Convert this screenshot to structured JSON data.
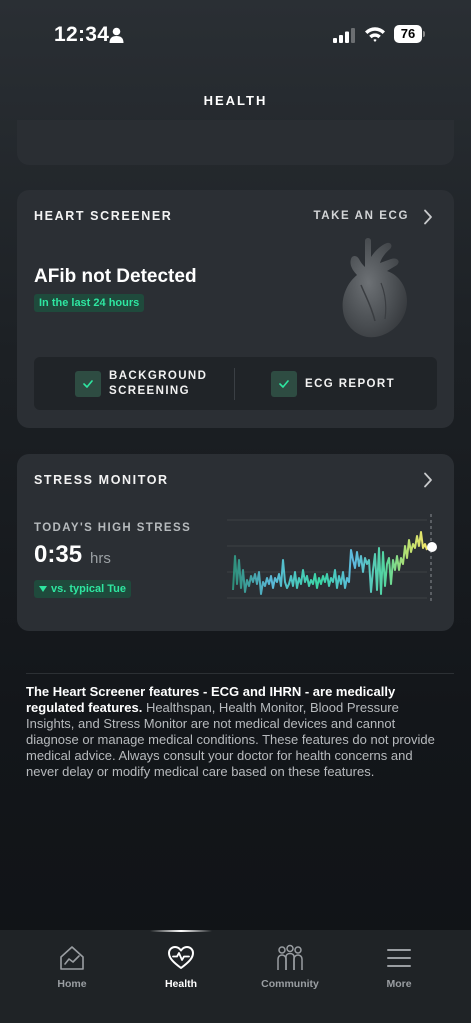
{
  "status_bar": {
    "time": "12:34",
    "battery": "76"
  },
  "header": {
    "title": "HEALTH"
  },
  "heart_screener": {
    "title": "HEART SCREENER",
    "action": "TAKE AN ECG",
    "result": "AFib not Detected",
    "period": "In the last 24 hours",
    "background_screening_line1": "BACKGROUND",
    "background_screening_line2": "SCREENING",
    "ecg_report": "ECG REPORT"
  },
  "stress_monitor": {
    "title": "STRESS MONITOR",
    "subtitle": "TODAY'S HIGH STRESS",
    "value": "0:35",
    "unit": "hrs",
    "comparison": "vs. typical Tue"
  },
  "disclaimer": {
    "bold": "The Heart Screener features - ECG and IHRN - are medically regulated features.",
    "body": " Healthspan, Health Monitor, Blood Pressure Insights, and Stress Monitor are not medical devices and cannot diagnose or manage medical conditions. These features do not provide medical advice. Always consult your doctor for health concerns and never delay or modify medical care based on these features."
  },
  "tabs": [
    {
      "label": "Home",
      "icon": "home-icon",
      "active": false
    },
    {
      "label": "Health",
      "icon": "heart-pulse-icon",
      "active": true
    },
    {
      "label": "Community",
      "icon": "community-icon",
      "active": false
    },
    {
      "label": "More",
      "icon": "menu-icon",
      "active": false
    }
  ],
  "colors": {
    "accent_green": "#2ee6a0",
    "badge_bg": "#1f4a3c",
    "card_bg": "#2b2f34"
  }
}
